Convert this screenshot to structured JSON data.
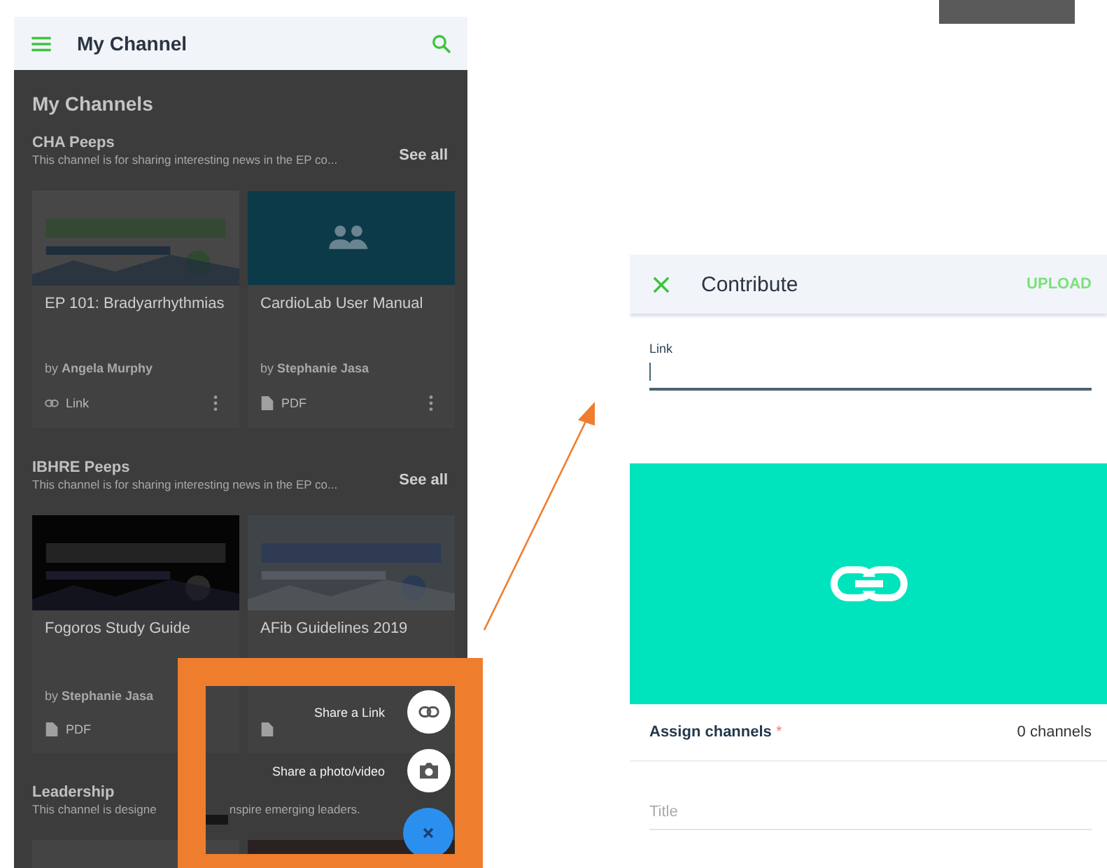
{
  "left_screen": {
    "app_bar": {
      "title": "My Channel"
    },
    "heading": "My Channels",
    "sections": [
      {
        "name": "CHA Peeps",
        "description": "This channel is for sharing interesting news in the EP co...",
        "see_all": "See all",
        "cards": [
          {
            "thumbnail": {
              "kind": "picture"
            },
            "title": "EP 101: Bradyarrhythmias",
            "author": "by **Angela Murphy**",
            "type": {
              "kind": "link",
              "label": "Link"
            },
            "menu": true
          },
          {
            "thumbnail": {
              "kind": "placeholder"
            },
            "title": "CardioLab User Manual",
            "author": "by **Stephanie Jasa**",
            "type": {
              "kind": "pdf",
              "label": "PDF"
            },
            "menu": true
          }
        ]
      },
      {
        "name": "IBHRE Peeps",
        "description": "This channel is for sharing interesting news in the EP co...",
        "see_all": "See all",
        "cards": [
          {
            "thumbnail": {
              "kind": "picture"
            },
            "title": "Fogoros Study Guide",
            "author": "by **Stephanie Jasa**",
            "type": {
              "kind": "pdf",
              "label": "PDF"
            },
            "menu": false
          },
          {
            "thumbnail": {
              "kind": "picture"
            },
            "title": "AFib Guidelines 2019",
            "type": {
              "kind": "pdf"
            },
            "menu": false
          }
        ]
      },
      {
        "name": "Leadership",
        "description": "This channel is designe",
        "description_tail": "nspire emerging leaders.",
        "cards": [
          {
            "thumbnail": {
              "kind": "blank"
            }
          },
          {
            "thumbnail": {
              "kind": "picture"
            }
          }
        ]
      }
    ],
    "fab_menu": {
      "actions": [
        {
          "label": "Share a Link",
          "kind": "link"
        },
        {
          "label": "Share a photo/video",
          "kind": "camera"
        }
      ]
    }
  },
  "right_screen": {
    "title": "Contribute",
    "action": "UPLOAD",
    "link_field": {
      "label": "Link"
    },
    "assign": {
      "label": "Assign channels",
      "required_mark": "*",
      "value": "0 channels"
    },
    "title_field": {
      "placeholder": "Title"
    }
  }
}
